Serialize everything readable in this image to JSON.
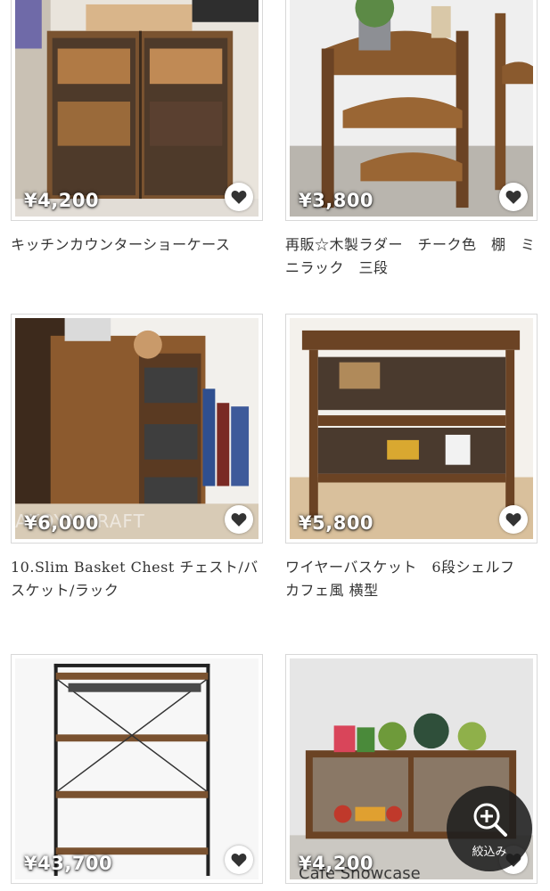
{
  "products": [
    {
      "price": "¥4,200",
      "title": "キッチンカウンターショーケース"
    },
    {
      "price": "¥3,800",
      "title": "再販☆木製ラダー　チーク色　棚　ミニラック　三段"
    },
    {
      "price": "¥6,000",
      "title": "10.Slim Basket Chest チェスト/バスケット/ラック",
      "watermark": "AKOYA.CRAFT"
    },
    {
      "price": "¥5,800",
      "title": "ワイヤーバスケット　6段シェルフ　カフェ風 横型"
    },
    {
      "price": "¥43,700",
      "title": ""
    },
    {
      "price": "¥4,200",
      "title": "",
      "sign": "Cafe Showcase"
    }
  ],
  "filter_button": {
    "label": "絞込み",
    "icon": "zoom-in-icon"
  },
  "favorite_icon": "heart-icon",
  "colors": {
    "price_text": "#ffffff",
    "title_text": "#333333",
    "card_border": "#d8d8d8",
    "filter_bg": "#1e1e1e"
  }
}
